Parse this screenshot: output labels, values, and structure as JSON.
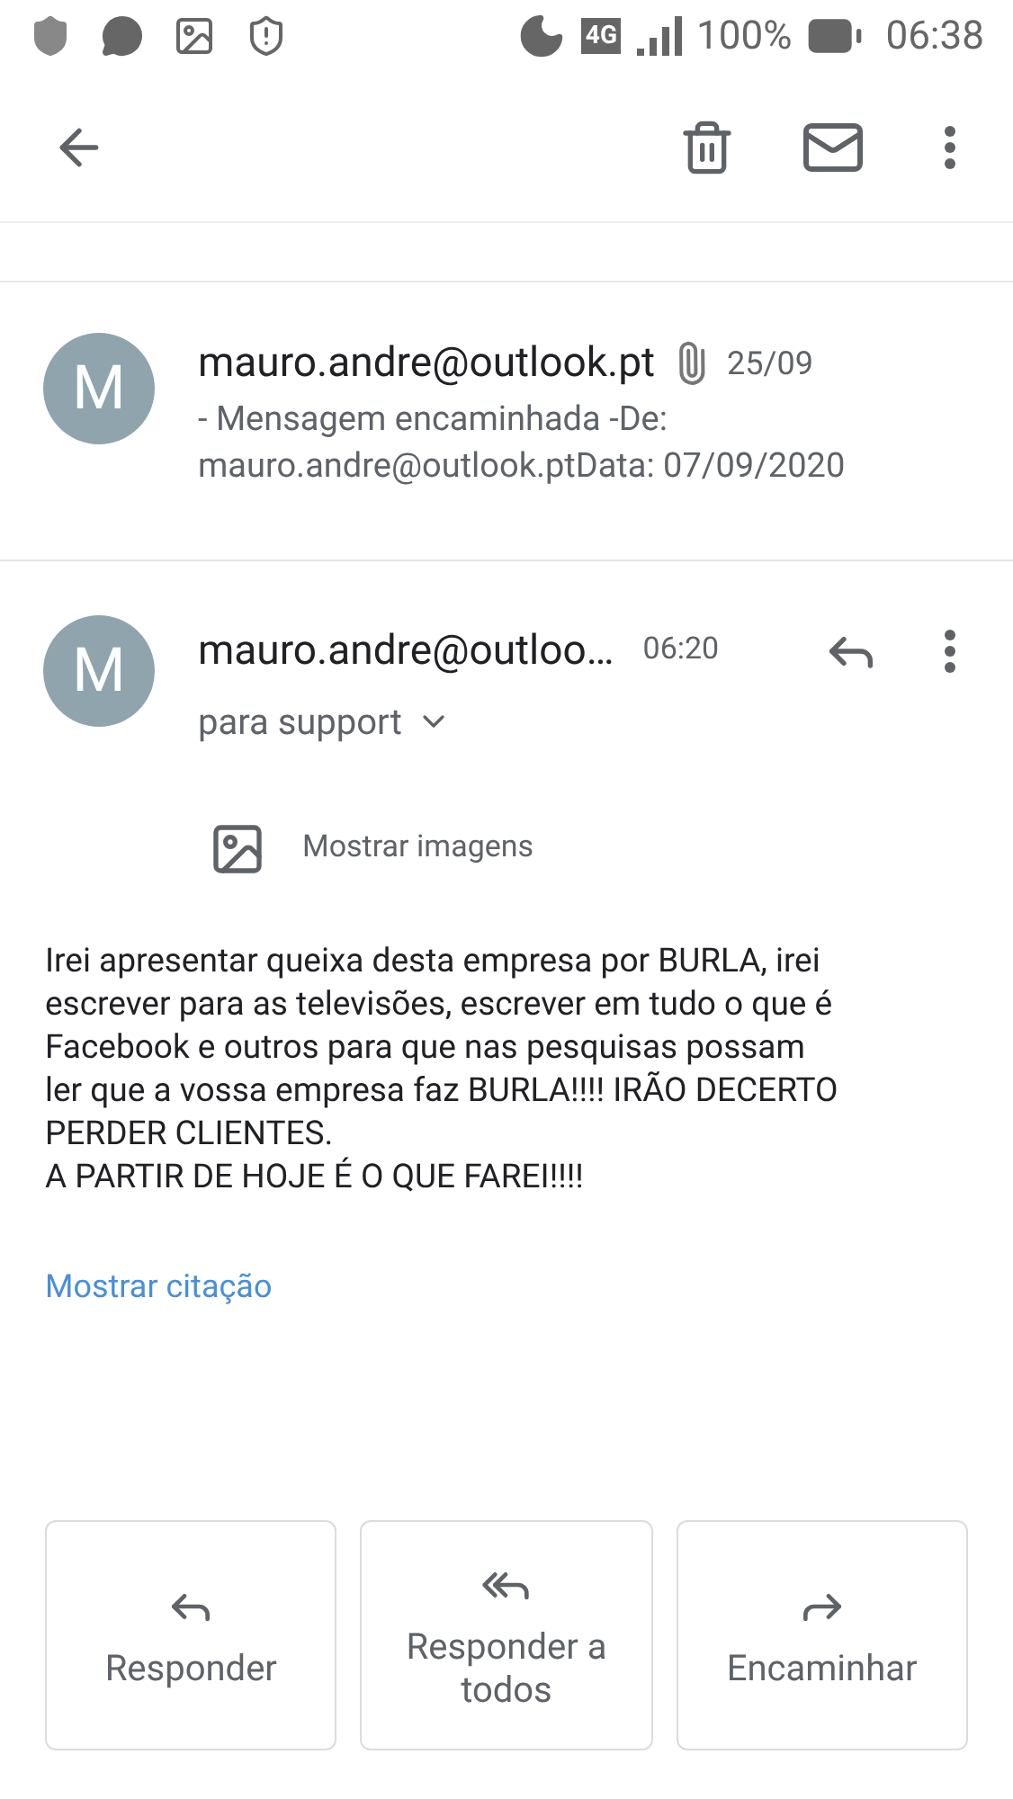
{
  "status_bar": {
    "network": "4G",
    "battery": "100%",
    "time": "06:38"
  },
  "collapsed_message": {
    "avatar": "M",
    "sender": "mauro.andre@outlook.pt",
    "attachment": true,
    "date": "25/09",
    "snippet_lines": [
      "- Mensagem encaminhada -De:",
      "mauro.andre@outlook.ptData: 07/09/2020"
    ]
  },
  "open_message": {
    "avatar": "M",
    "sender": "mauro.andre@outloo…",
    "time": "06:20",
    "recipients": "para support",
    "show_images": "Mostrar imagens",
    "body_lines": [
      "Irei apresentar queixa desta empresa por BURLA, irei",
      "escrever para as televisões, escrever em tudo o que é",
      "Facebook e outros para que nas pesquisas possam",
      "ler que a vossa empresa faz BURLA!!!! IRÃO DECERTO",
      "PERDER CLIENTES.",
      "A PARTIR DE HOJE É O QUE FAREI!!!!"
    ],
    "show_quote": "Mostrar citação"
  },
  "actions": [
    {
      "kind": "reply",
      "label": "Responder"
    },
    {
      "kind": "reply_all",
      "label": "Responder a todos"
    },
    {
      "kind": "forward",
      "label": "Encaminhar"
    }
  ]
}
